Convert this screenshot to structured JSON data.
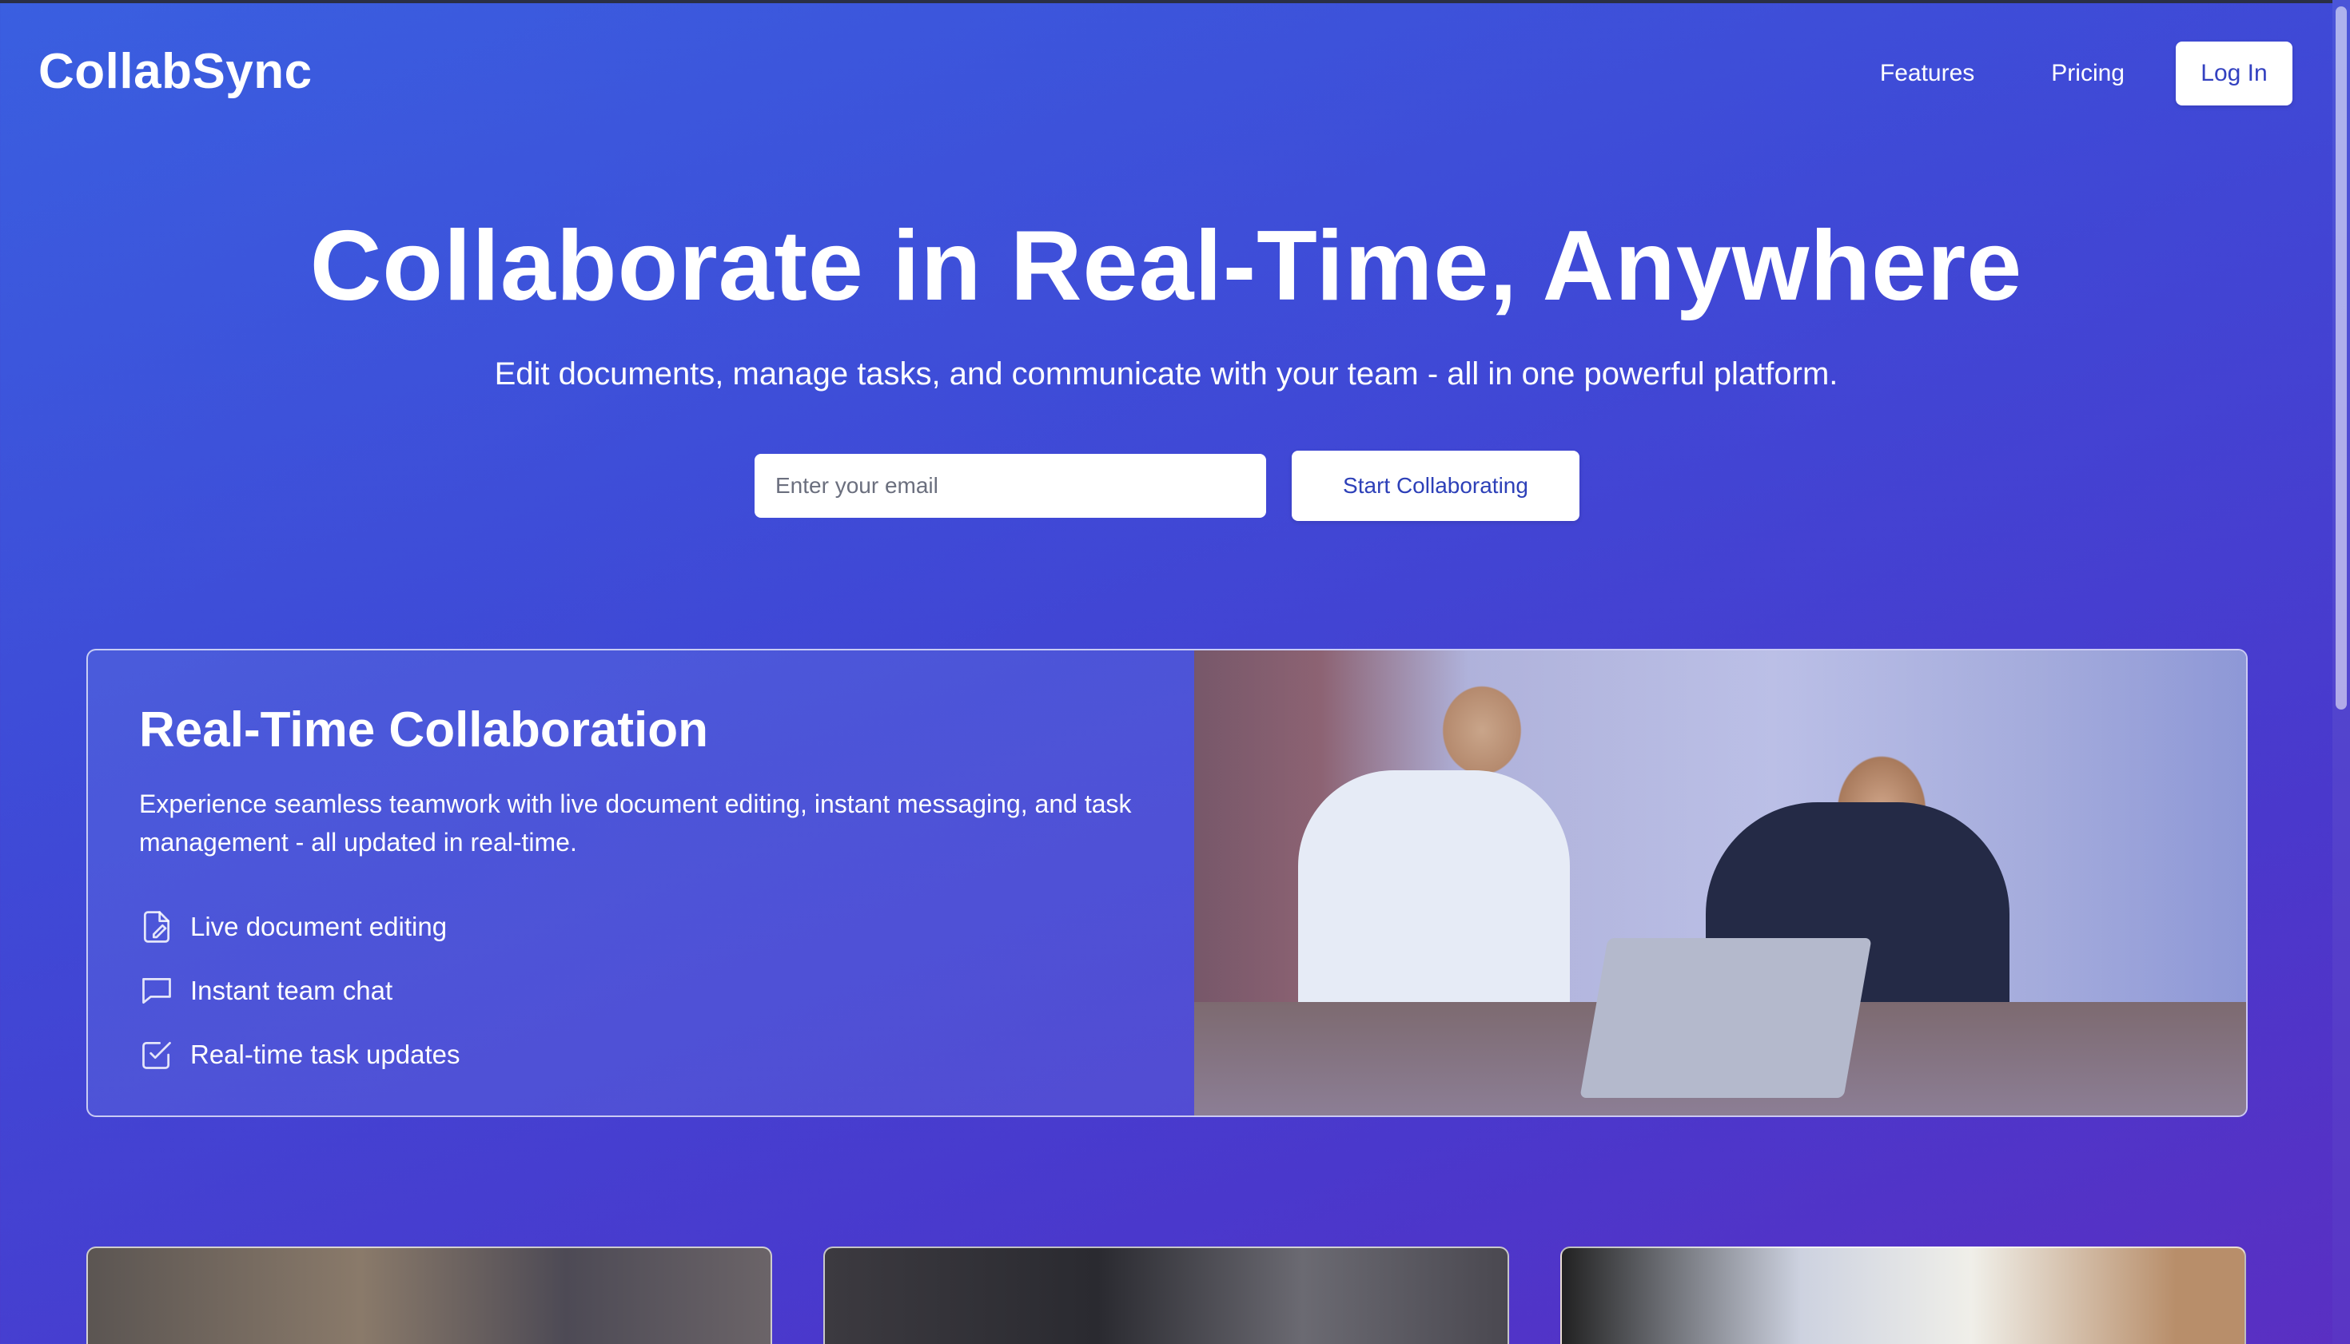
{
  "header": {
    "logo": "CollabSync",
    "nav": {
      "features_label": "Features",
      "pricing_label": "Pricing",
      "login_label": "Log In"
    }
  },
  "hero": {
    "title": "Collaborate in Real-Time, Anywhere",
    "subtitle": "Edit documents, manage tasks, and communicate with your team - all in one powerful platform.",
    "email_placeholder": "Enter your email",
    "cta_label": "Start Collaborating"
  },
  "feature": {
    "title": "Real-Time Collaboration",
    "description": "Experience seamless teamwork with live document editing, instant messaging, and task management - all updated in real-time.",
    "items": [
      {
        "label": "Live document editing",
        "icon": "document-edit-icon"
      },
      {
        "label": "Instant team chat",
        "icon": "chat-icon"
      },
      {
        "label": "Real-time task updates",
        "icon": "check-square-icon"
      }
    ]
  },
  "colors": {
    "accent_text": "#3341c0",
    "background_start": "#3a5fe0",
    "background_end": "#5a2fc2"
  }
}
